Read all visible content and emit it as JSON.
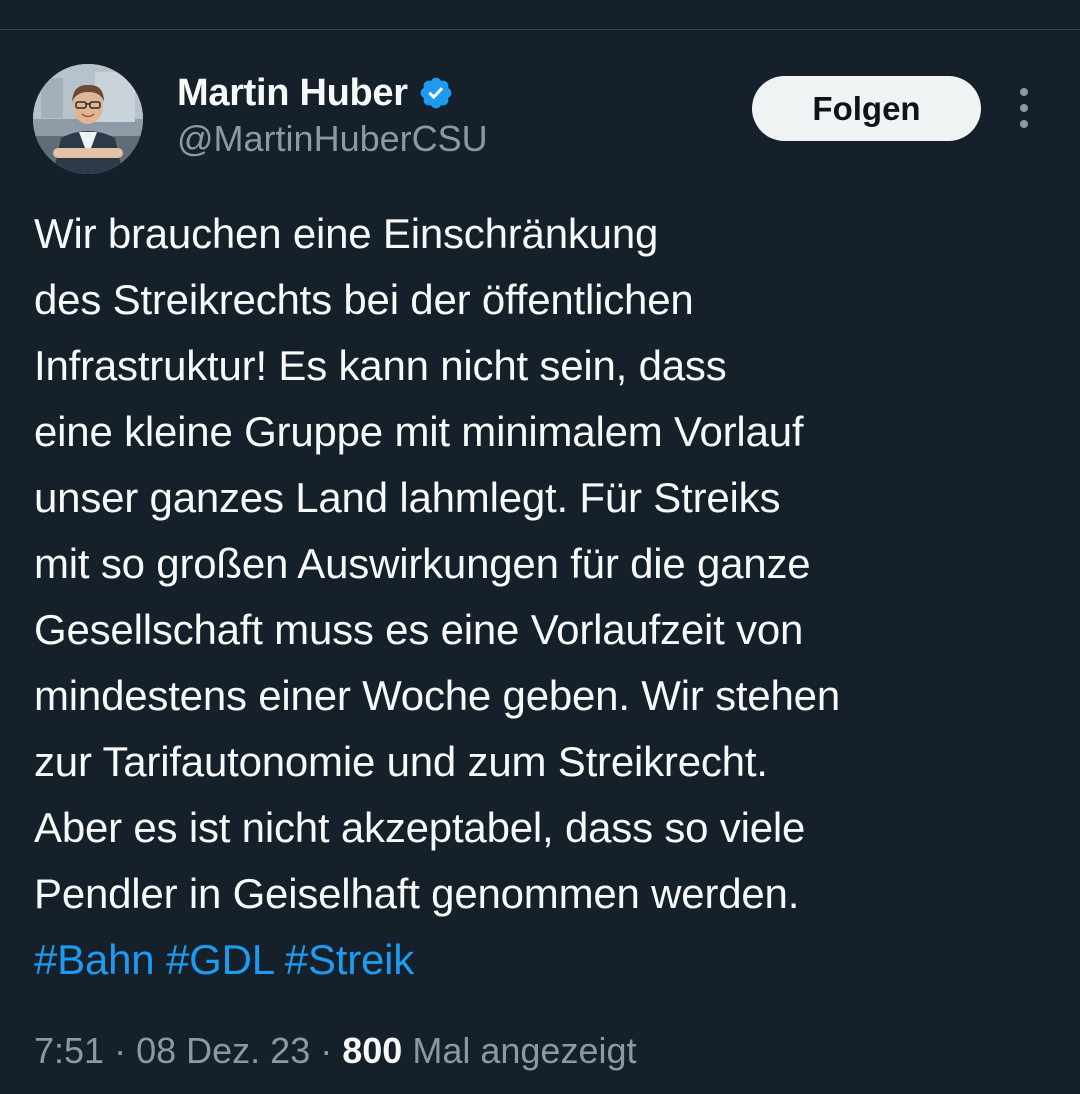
{
  "author": {
    "name": "Martin Huber",
    "handle": "@MartinHuberCSU",
    "verified_icon": "verified-badge-icon",
    "verified_color": "#1d9bf0"
  },
  "actions": {
    "follow_label": "Folgen",
    "more_icon": "more-options-icon"
  },
  "tweet": {
    "lines": [
      "Wir brauchen eine Einschränkung",
      "des Streikrechts bei der öffentlichen",
      "Infrastruktur! Es kann nicht sein, dass",
      "eine kleine Gruppe mit minimalem Vorlauf",
      "unser ganzes Land lahmlegt. Für Streiks",
      "mit so großen Auswirkungen für die ganze",
      "Gesellschaft muss es eine Vorlaufzeit von",
      "mindestens einer Woche geben. Wir stehen",
      "zur Tarifautonomie und zum Streikrecht.",
      "Aber es ist nicht akzeptabel, dass so viele",
      "Pendler in Geiselhaft genommen werden."
    ],
    "hashtags": [
      "#Bahn",
      "#GDL",
      "#Streik"
    ]
  },
  "meta": {
    "time": "7:51",
    "separator": "·",
    "date": "08 Dez. 23",
    "views_count": "800",
    "views_label": "Mal angezeigt"
  },
  "colors": {
    "background": "#15202b",
    "text": "#f7f9f9",
    "secondary": "#8b98a5",
    "link": "#1d9bf0",
    "button_bg": "#eff3f4"
  }
}
